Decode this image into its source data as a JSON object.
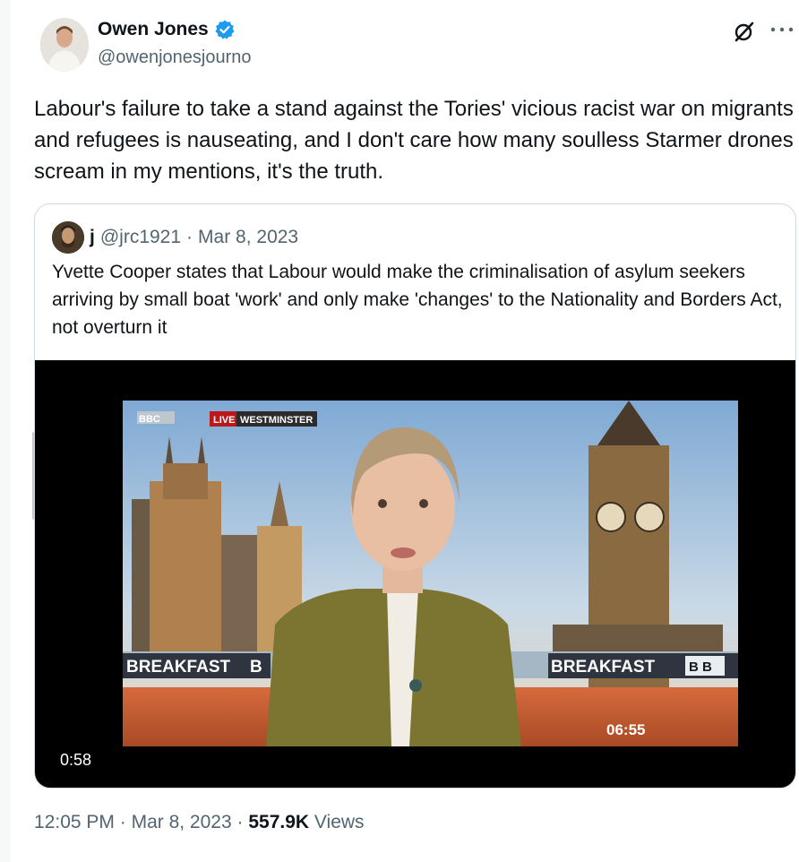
{
  "author": {
    "name": "Owen Jones",
    "handle": "@owenjonesjourno",
    "verified_color": "#1d9bf0"
  },
  "tweet": {
    "text": "Labour's failure to take a stand against the Tories' vicious racist war on migrants and refugees is nauseating, and I don't care how many soulless Starmer drones scream in my mentions, it's the truth."
  },
  "quoted": {
    "name": "j",
    "handle": "@jrc1921",
    "separator": "·",
    "date": "Mar 8, 2023",
    "text": "Yvette Cooper states that Labour would make the criminalisation of asylum seekers arriving by small boat 'work' and only make 'changes' to the Nationality and Borders Act, not overturn it",
    "video": {
      "duration": "0:58",
      "live_badge": "LIVE",
      "location_badge": "WESTMINSTER",
      "channel_logo": "BBC",
      "banner_left": "BREAKFAST",
      "banner_left_cut": "B",
      "banner_right": "BREAKFAST",
      "banner_right_logo": "B B",
      "clock": "06:55"
    }
  },
  "meta": {
    "time": "12:05 PM",
    "separator": "·",
    "date": "Mar 8, 2023",
    "views_count": "557.9K",
    "views_label": "Views"
  },
  "icons": {
    "grok": "grok-icon",
    "more": "more-icon",
    "verified": "verified-badge-icon"
  }
}
